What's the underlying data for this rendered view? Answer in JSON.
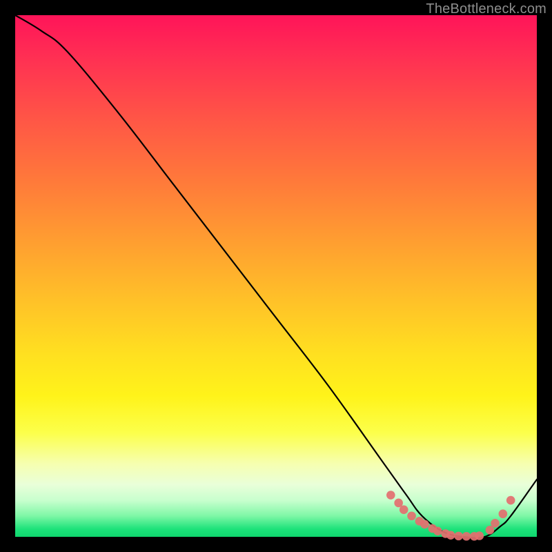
{
  "watermark": "TheBottleneck.com",
  "chart_data": {
    "type": "line",
    "title": "",
    "xlabel": "",
    "ylabel": "",
    "xlim": [
      0,
      100
    ],
    "ylim": [
      0,
      100
    ],
    "series": [
      {
        "name": "curve",
        "x": [
          0,
          5,
          10,
          20,
          30,
          40,
          50,
          60,
          70,
          75,
          78,
          82,
          86,
          90,
          93,
          95,
          100
        ],
        "values": [
          100,
          97,
          93,
          81,
          68,
          55,
          42,
          29,
          15,
          8,
          4,
          1,
          0,
          0,
          2,
          4,
          11
        ]
      }
    ],
    "scatter": {
      "name": "dots",
      "color": "#e36f6f",
      "x": [
        72,
        73.5,
        74.5,
        76,
        77.5,
        78.5,
        80,
        81,
        82.5,
        83.5,
        85,
        86.5,
        88,
        89,
        91,
        92,
        93.5,
        95
      ],
      "values": [
        8,
        6.5,
        5.2,
        4,
        3.0,
        2.4,
        1.6,
        1.1,
        0.6,
        0.3,
        0.15,
        0.1,
        0.1,
        0.2,
        1.3,
        2.6,
        4.4,
        7.0
      ]
    }
  }
}
